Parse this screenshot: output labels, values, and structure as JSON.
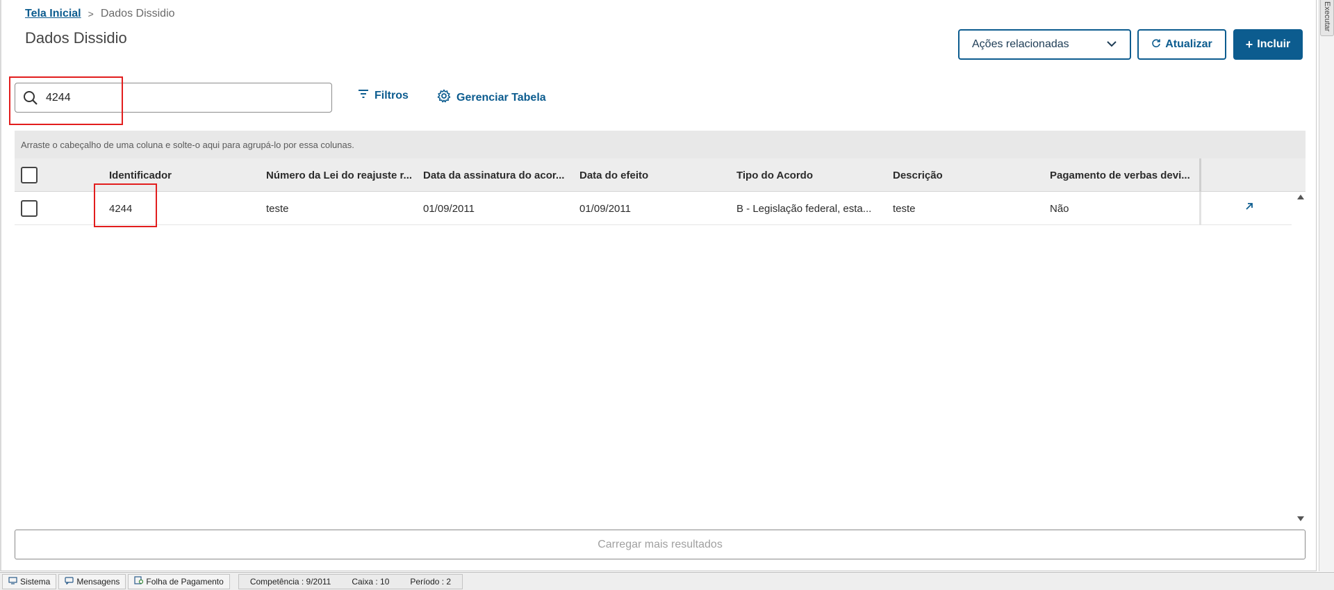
{
  "breadcrumb": {
    "home": "Tela Inicial",
    "separator": ">",
    "current": "Dados Dissidio"
  },
  "page": {
    "title": "Dados Dissidio"
  },
  "actions": {
    "related": "Ações relacionadas",
    "refresh": "Atualizar",
    "add": "Incluir",
    "add_icon": "+"
  },
  "search": {
    "value": "4244",
    "icon": "search-icon"
  },
  "toolbar": {
    "filters": "Filtros",
    "manage_table": "Gerenciar Tabela"
  },
  "table": {
    "group_hint": "Arraste o cabeçalho de uma coluna e solte-o aqui para agrupá-lo por essa colunas.",
    "columns": [
      "Identificador",
      "Número da Lei do reajuste r...",
      "Data da assinatura do acor...",
      "Data do efeito",
      "Tipo do Acordo",
      "Descrição",
      "Pagamento de verbas devi..."
    ],
    "rows": [
      {
        "identificador": "4244",
        "numero_lei": "teste",
        "data_assinatura": "01/09/2011",
        "data_efeito": "01/09/2011",
        "tipo_acordo": "B - Legislação federal, esta...",
        "descricao": "teste",
        "pagamento": "Não"
      }
    ],
    "load_more": "Carregar mais resultados"
  },
  "side": {
    "exec_label": "Executar"
  },
  "status_bar": {
    "sistema": "Sistema",
    "mensagens": "Mensagens",
    "modulo": "Folha de Pagamento",
    "competencia": "Competência : 9/2011",
    "caixa": "Caixa : 10",
    "periodo": "Período : 2"
  },
  "colors": {
    "primary": "#0c5c8f",
    "highlight": "#e21d1d",
    "header_bg": "#ededed"
  }
}
